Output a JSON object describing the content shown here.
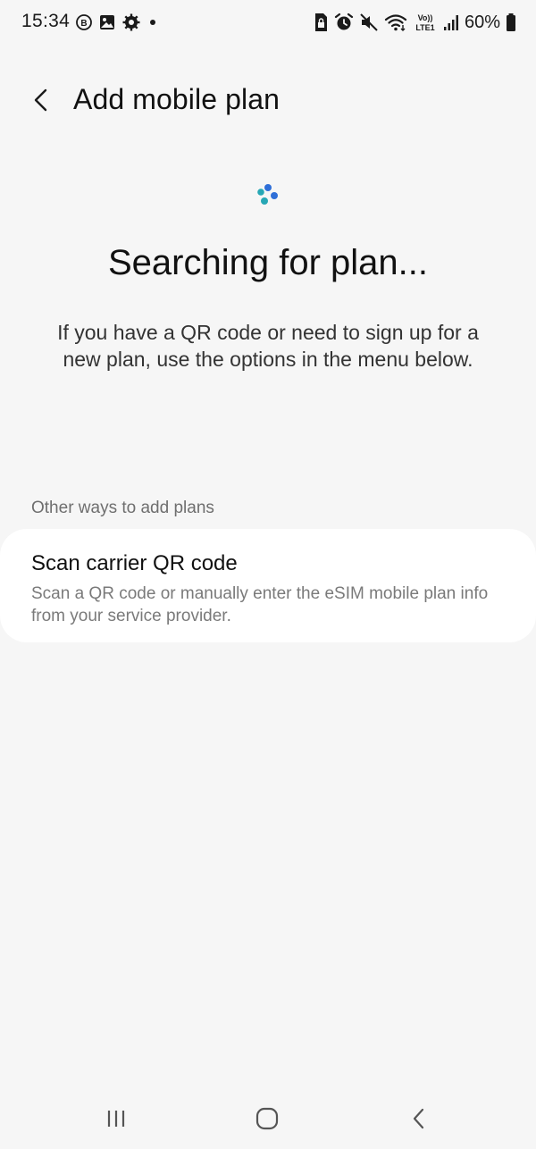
{
  "status_bar": {
    "time": "15:34",
    "left_icons": [
      "b-badge-icon",
      "gallery-icon",
      "settings-gear-icon",
      "dot-icon"
    ],
    "right_icons": [
      "sim-lock-icon",
      "alarm-icon",
      "mute-icon",
      "wifi-icon",
      "volte-lte-icon",
      "signal-icon"
    ],
    "volte_label": "Vo))",
    "lte_label": "LTE1",
    "battery_percent": "60%"
  },
  "header": {
    "title": "Add mobile plan"
  },
  "main": {
    "search_title": "Searching for plan...",
    "search_description": "If you have a QR code or need to sign up for a new plan, use the options in the menu below.",
    "section_label": "Other ways to add plans",
    "option": {
      "title": "Scan carrier QR code",
      "subtitle": "Scan a QR code or manually enter the eSIM mobile plan info from your service provider."
    }
  },
  "colors": {
    "background": "#f6f6f6",
    "card": "#ffffff",
    "spinner_teal": "#27a7b5",
    "spinner_blue": "#2f6fd8"
  }
}
